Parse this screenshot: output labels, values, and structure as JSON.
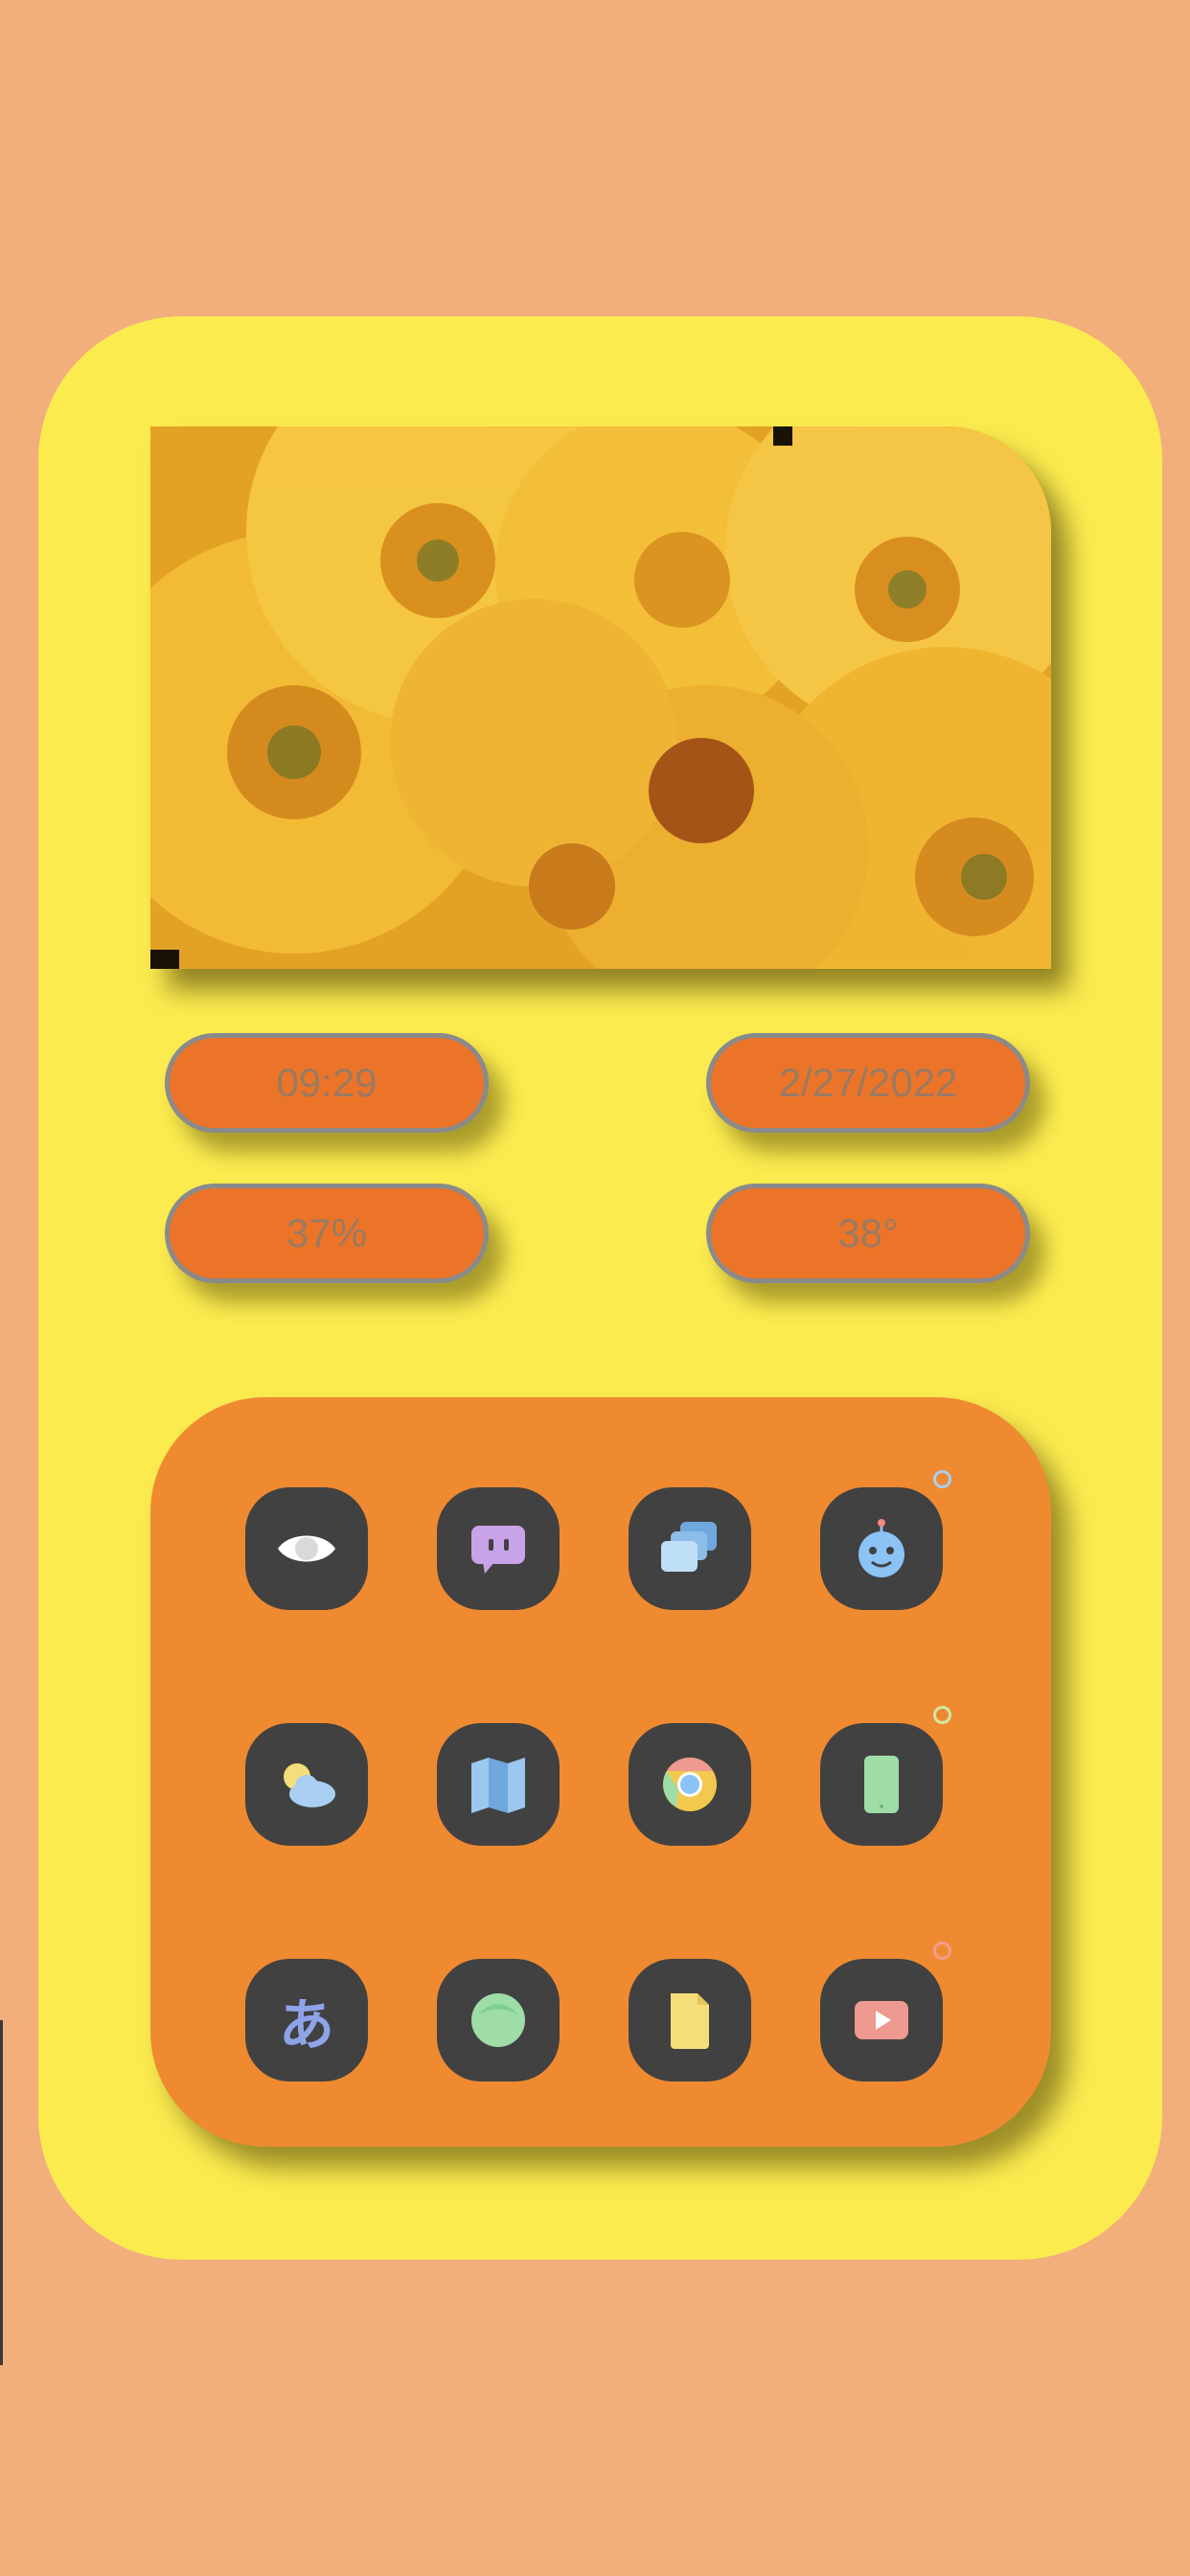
{
  "widgets": {
    "time": "09:29",
    "date": "2/27/2022",
    "battery": "37%",
    "temperature": "38°"
  },
  "apps": [
    {
      "icon": "eye-icon",
      "color": "#FFFFFF"
    },
    {
      "icon": "chat-bubble-icon",
      "color": "#C9A3E8"
    },
    {
      "icon": "stacked-windows-icon",
      "color": "#A9CFF2"
    },
    {
      "icon": "robot-icon",
      "color": "#8CC3F5"
    },
    {
      "icon": "weather-icon",
      "color": "#A9CFF2"
    },
    {
      "icon": "map-icon",
      "color": "#9CC7EE"
    },
    {
      "icon": "chrome-icon",
      "color": "#F2C94C"
    },
    {
      "icon": "phone-icon",
      "color": "#9EDDA8"
    },
    {
      "icon": "hiragana-icon",
      "color": "#8FA3E8",
      "glyph": "あ"
    },
    {
      "icon": "circle-icon",
      "color": "#9EDDA8"
    },
    {
      "icon": "document-icon",
      "color": "#F4DE7A"
    },
    {
      "icon": "video-play-icon",
      "color": "#EE9A91"
    }
  ],
  "page_indicators": [
    {
      "color": "#A9CFF2"
    },
    {
      "color": "#CFE7A4"
    },
    {
      "color": "#F39C8E"
    }
  ],
  "colors": {
    "background": "#F2AE7B",
    "card": "#FCEB4F",
    "pill": "#EC7428",
    "panel": "#EF8A31",
    "app_tile": "#414141"
  }
}
